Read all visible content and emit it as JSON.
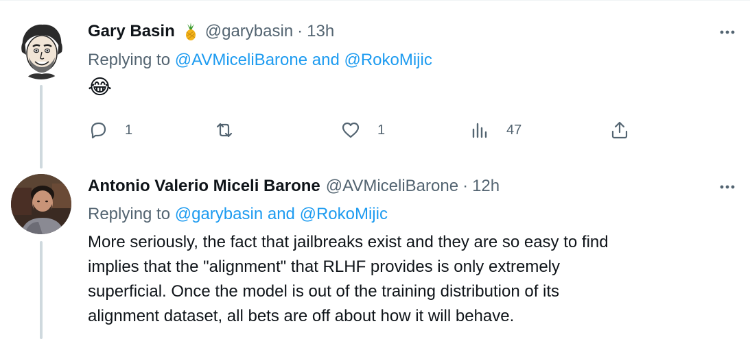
{
  "tweets": [
    {
      "name": "Gary Basin",
      "badge_icon": "pineapple-icon",
      "handle": "@garybasin",
      "separator": "·",
      "time": "13h",
      "replying_prefix": "Replying to",
      "mention1": "@AVMiceliBarone",
      "and": "and",
      "mention2": "@RokoMijic",
      "body": "😂",
      "actions": {
        "reply_count": "1",
        "retweet_count": "",
        "like_count": "1",
        "views_count": "47"
      }
    },
    {
      "name": "Antonio Valerio Miceli Barone",
      "handle": "@AVMiceliBarone",
      "separator": "·",
      "time": "12h",
      "replying_prefix": "Replying to",
      "mention1": "@garybasin",
      "and": "and",
      "mention2": "@RokoMijic",
      "body_lines": [
        "More seriously, the fact that jailbreaks exist and they are so easy to find",
        "implies that the \"alignment\" that RLHF provides is only extremely",
        "superficial. Once the model is out of the training distribution of its",
        "alignment dataset, all bets are off about how it will behave."
      ]
    }
  ],
  "colors": {
    "text": "#0f1419",
    "secondary": "#536471",
    "link": "#1d9bf0",
    "thread_line": "#cfd9de"
  }
}
